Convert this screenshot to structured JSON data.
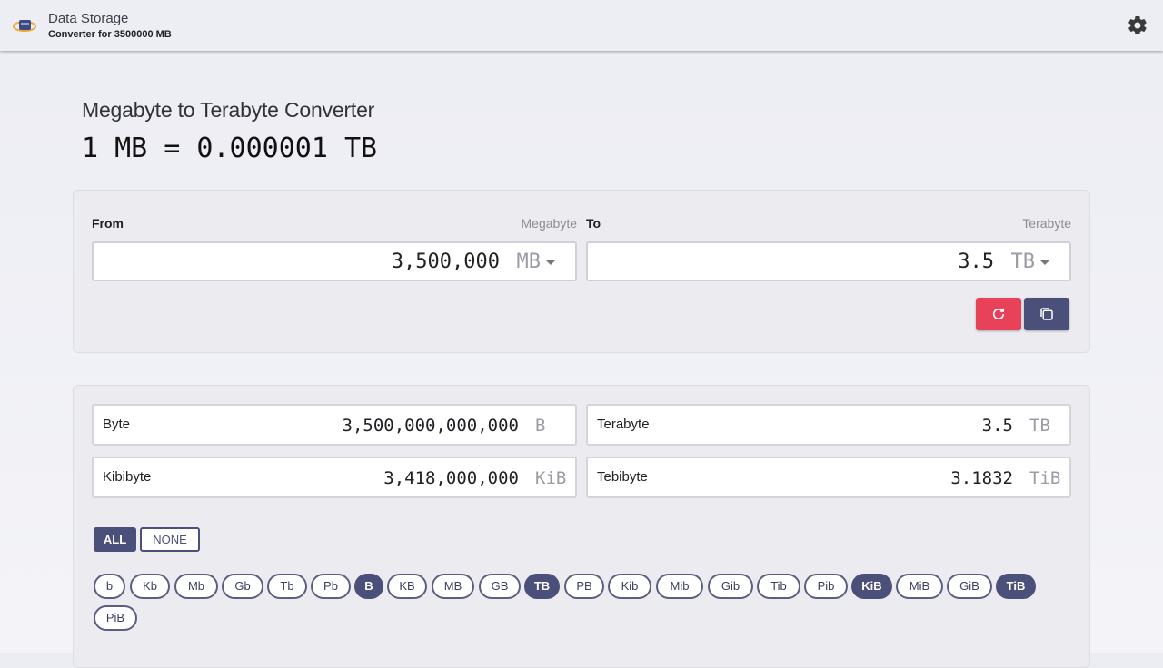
{
  "header": {
    "title": "Data Storage",
    "subtitle": "Converter for 3500000 MB",
    "settings_icon": "gear-icon"
  },
  "main": {
    "heading": "Megabyte to Terabyte Converter",
    "formula": "1 MB = 0.000001 TB"
  },
  "converter": {
    "from_label": "From",
    "from_unit_name": "Megabyte",
    "from_value": "3,500,000",
    "from_unit": "MB",
    "to_label": "To",
    "to_unit_name": "Terabyte",
    "to_value": "3.5",
    "to_unit": "TB",
    "reset_icon": "refresh-icon",
    "copy_icon": "copy-icon",
    "colors": {
      "reset": "#e8425a",
      "primary": "#4a5079"
    }
  },
  "results": [
    {
      "name": "Byte",
      "value": "3,500,000,000,000",
      "unit": "B"
    },
    {
      "name": "Terabyte",
      "value": "3.5",
      "unit": "TB"
    },
    {
      "name": "Kibibyte",
      "value": "3,418,000,000",
      "unit": "KiB"
    },
    {
      "name": "Tebibyte",
      "value": "3.1832",
      "unit": "TiB"
    }
  ],
  "selection": {
    "all": "ALL",
    "none": "NONE"
  },
  "units": [
    {
      "label": "b",
      "selected": false
    },
    {
      "label": "Kb",
      "selected": false
    },
    {
      "label": "Mb",
      "selected": false
    },
    {
      "label": "Gb",
      "selected": false
    },
    {
      "label": "Tb",
      "selected": false
    },
    {
      "label": "Pb",
      "selected": false
    },
    {
      "label": "B",
      "selected": true
    },
    {
      "label": "KB",
      "selected": false
    },
    {
      "label": "MB",
      "selected": false
    },
    {
      "label": "GB",
      "selected": false
    },
    {
      "label": "TB",
      "selected": true
    },
    {
      "label": "PB",
      "selected": false
    },
    {
      "label": "Kib",
      "selected": false
    },
    {
      "label": "Mib",
      "selected": false
    },
    {
      "label": "Gib",
      "selected": false
    },
    {
      "label": "Tib",
      "selected": false
    },
    {
      "label": "Pib",
      "selected": false
    },
    {
      "label": "KiB",
      "selected": true
    },
    {
      "label": "MiB",
      "selected": false
    },
    {
      "label": "GiB",
      "selected": false
    },
    {
      "label": "TiB",
      "selected": true
    },
    {
      "label": "PiB",
      "selected": false
    }
  ]
}
